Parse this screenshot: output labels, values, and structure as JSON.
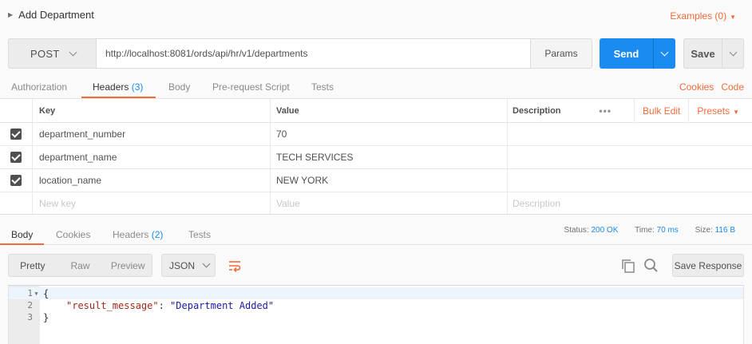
{
  "request": {
    "name": "Add Department",
    "examples_label": "Examples (0)",
    "method": "POST",
    "url": "http://localhost:8081/ords/api/hr/v1/departments",
    "params_label": "Params",
    "send_label": "Send",
    "save_label": "Save"
  },
  "request_tabs": {
    "authorization": "Authorization",
    "headers": "Headers",
    "headers_count": "(3)",
    "body": "Body",
    "prerequest": "Pre-request Script",
    "tests": "Tests",
    "cookies": "Cookies",
    "code": "Code"
  },
  "headers_table": {
    "columns": {
      "key": "Key",
      "value": "Value",
      "description": "Description"
    },
    "more_label": "•••",
    "bulk_edit": "Bulk Edit",
    "presets": "Presets",
    "rows": [
      {
        "key": "department_number",
        "value": "70",
        "description": "",
        "checked": true
      },
      {
        "key": "department_name",
        "value": "TECH SERVICES",
        "description": "",
        "checked": true
      },
      {
        "key": "location_name",
        "value": "NEW YORK",
        "description": "",
        "checked": true
      }
    ],
    "new_row": {
      "key_placeholder": "New key",
      "value_placeholder": "Value",
      "description_placeholder": "Description"
    }
  },
  "response_tabs": {
    "body": "Body",
    "cookies": "Cookies",
    "headers": "Headers",
    "headers_count": "(2)",
    "tests": "Tests"
  },
  "response_status": {
    "status_label": "Status:",
    "status_value": "200 OK",
    "time_label": "Time:",
    "time_value": "70 ms",
    "size_label": "Size:",
    "size_value": "116 B"
  },
  "response_toolbar": {
    "pretty": "Pretty",
    "raw": "Raw",
    "preview": "Preview",
    "language": "JSON",
    "save_response": "Save Response"
  },
  "response_body": {
    "line_numbers": [
      "1",
      "2",
      "3"
    ],
    "open_brace": "{",
    "key": "\"result_message\"",
    "colon": ": ",
    "value": "\"Department Added\"",
    "close_brace": "}"
  },
  "colors": {
    "accent_orange": "#f26b3a",
    "send_blue": "#1a8bf0",
    "link_blue": "#1a8bf0"
  },
  "icons": {
    "caret": "caret-right-icon",
    "wrap": "wrap-lines-icon",
    "copy": "copy-icon",
    "search": "search-icon"
  }
}
